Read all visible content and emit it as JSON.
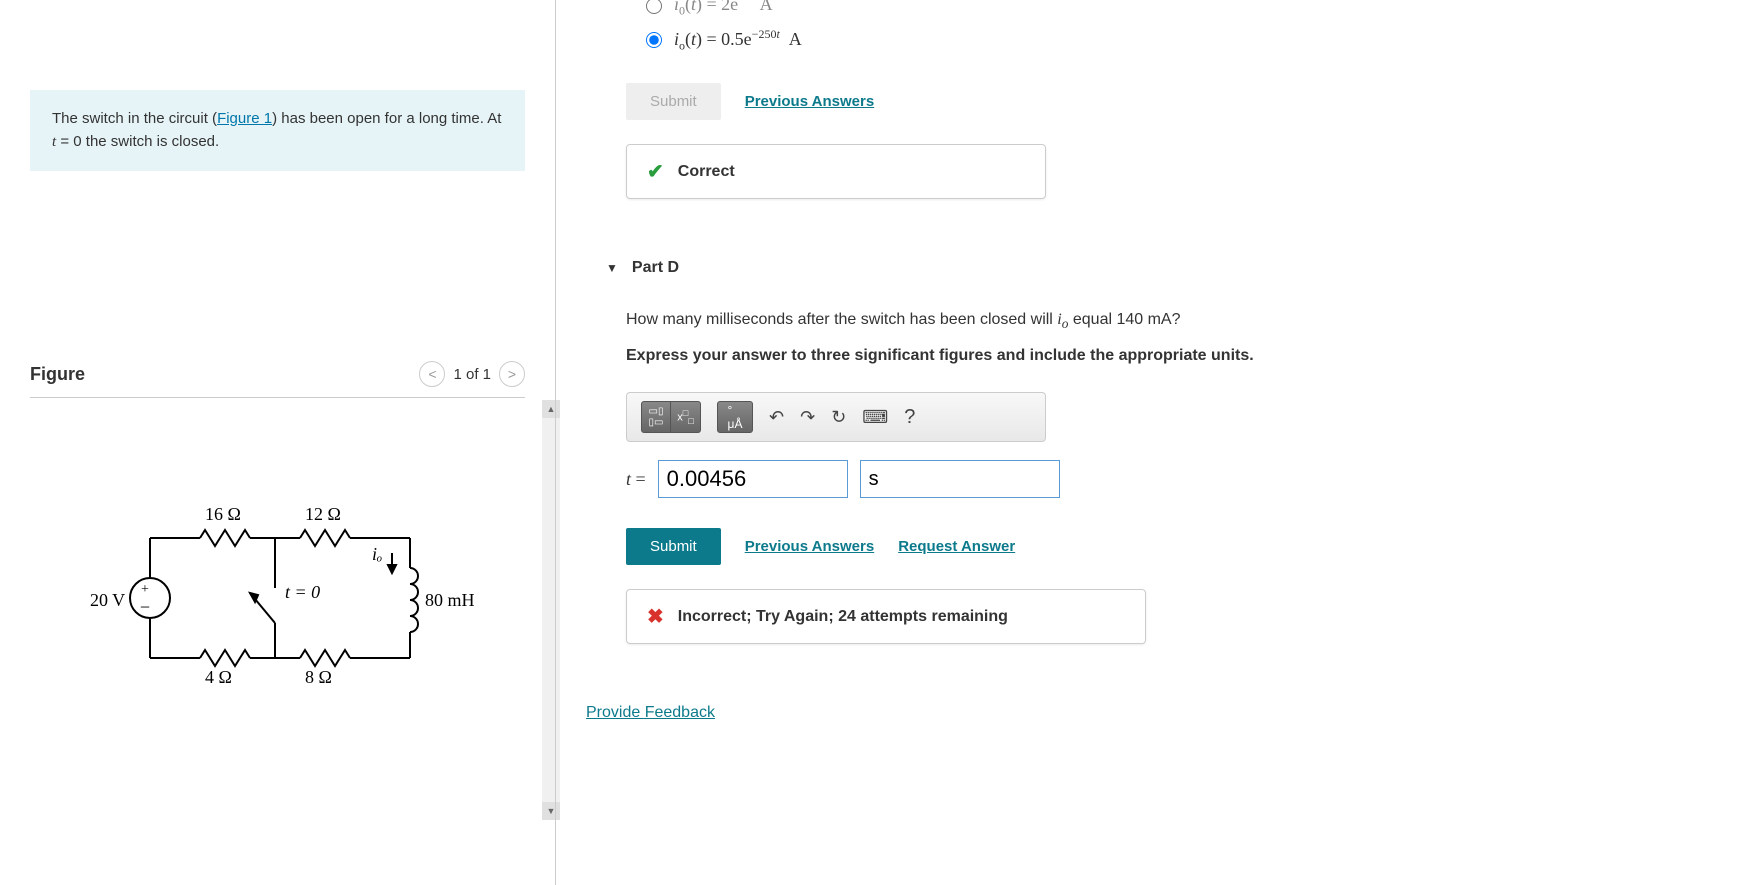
{
  "problem": {
    "text_before_link": "The switch in the circuit (",
    "figure_link": "Figure 1",
    "text_after_link": ") has been open for a long time. At ",
    "time_var": "t",
    "text_end": " = 0 the switch is closed."
  },
  "figure": {
    "title": "Figure",
    "counter": "1 of 1",
    "labels": {
      "r16": "16 Ω",
      "r12": "12 Ω",
      "r4": "4 Ω",
      "r8": "8 Ω",
      "v20": "20 V",
      "t0": "t = 0",
      "io": "iₒ",
      "l80": "80 mH"
    }
  },
  "partC": {
    "option1_truncated": "i₀(t) = 2e    A",
    "option2": "iₒ(t) = 0.5e⁻²⁵⁰ᵗ  A",
    "submit": "Submit",
    "prev": "Previous Answers",
    "correct": "Correct"
  },
  "partD": {
    "header": "Part D",
    "question": "How many milliseconds after the switch has been closed will iₒ equal 140 mA?",
    "instruction": "Express your answer to three significant figures and include the appropriate units.",
    "t_label": "t = ",
    "value": "0.00456",
    "unit": "s",
    "submit": "Submit",
    "prev": "Previous Answers",
    "request": "Request Answer",
    "incorrect": "Incorrect; Try Again; 24 attempts remaining"
  },
  "toolbar": {
    "templates": "▢",
    "script": "x□",
    "units": "μÅ",
    "undo": "↶",
    "redo": "↷",
    "reset": "↻",
    "keyboard": "⌨",
    "help": "?"
  },
  "feedback_link": "Provide Feedback"
}
